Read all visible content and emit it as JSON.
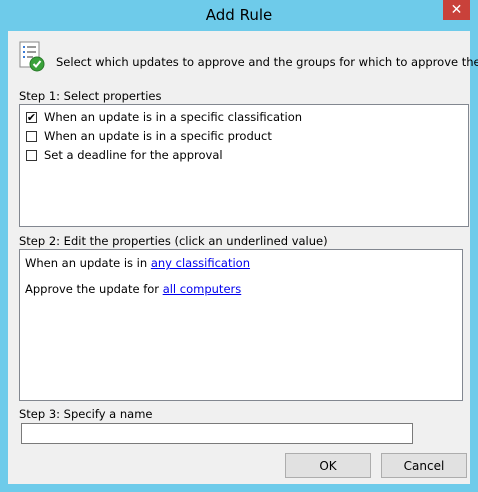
{
  "window": {
    "title": "Add Rule",
    "close_symbol": "✕"
  },
  "header": {
    "text": "Select which updates to approve and the groups for which to approve them."
  },
  "step1": {
    "label": "Step 1: Select properties",
    "items": [
      {
        "label": "When an update is in a specific classification",
        "checked": true,
        "mark": "✔"
      },
      {
        "label": "When an update is in a specific product",
        "checked": false,
        "mark": ""
      },
      {
        "label": "Set a deadline for the approval",
        "checked": false,
        "mark": ""
      }
    ]
  },
  "step2": {
    "label": "Step 2: Edit the properties (click an underlined value)",
    "line1_prefix": "When an update is in ",
    "line1_link": "any classification",
    "line2_prefix": "Approve the update for ",
    "line2_link": "all computers"
  },
  "step3": {
    "label": "Step 3: Specify a name",
    "value": ""
  },
  "buttons": {
    "ok": "OK",
    "cancel": "Cancel"
  },
  "colors": {
    "title_bar": "#6ecbea",
    "close_button": "#c9413a",
    "link": "#0000ee"
  },
  "icons": {
    "header": "checklist-approve-icon"
  }
}
